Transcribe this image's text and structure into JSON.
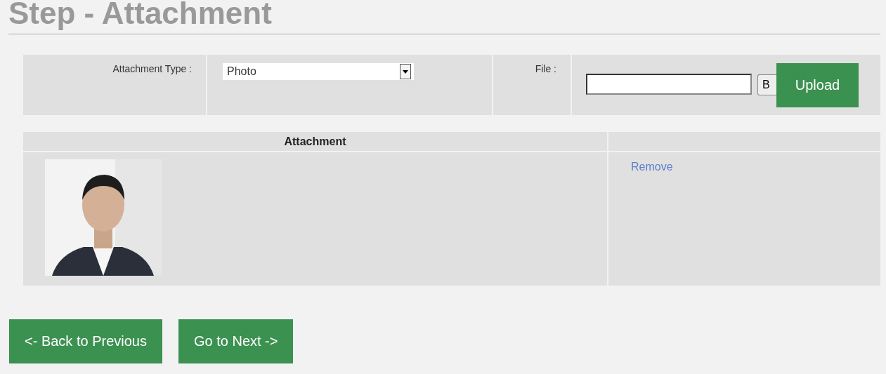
{
  "title": "Step - Attachment",
  "form": {
    "type_label": "Attachment Type :",
    "type_value": "Photo",
    "file_label": "File :",
    "browse_label": "B",
    "upload_label": "Upload"
  },
  "table": {
    "columns": [
      "Attachment"
    ],
    "rows": [
      {
        "action": "Remove"
      }
    ]
  },
  "buttons": [
    "<- Back to Previous",
    "Go to Next ->"
  ]
}
